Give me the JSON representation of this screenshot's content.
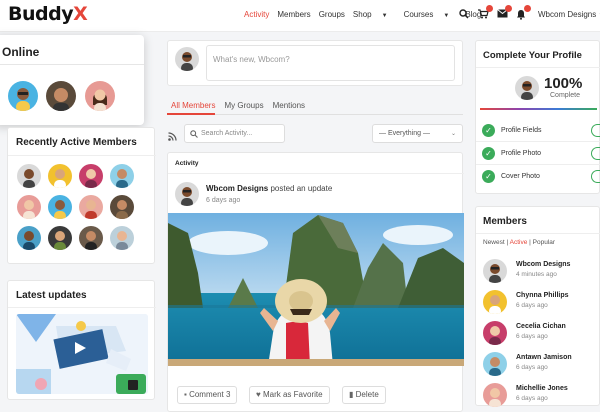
{
  "brand": {
    "name": "Buddy",
    "x": "X"
  },
  "nav": {
    "items": [
      "Activity",
      "Members",
      "Groups",
      "Shop",
      "Courses",
      "Blog"
    ],
    "user": "Wbcom Designs"
  },
  "online": {
    "title": "Online"
  },
  "recent": {
    "title": "Recently Active Members"
  },
  "latest": {
    "title": "Latest updates"
  },
  "composer": {
    "placeholder": "What's new, Wbcom?"
  },
  "tabs": [
    "All Members",
    "My Groups",
    "Mentions"
  ],
  "search": {
    "placeholder": "Search Activity..."
  },
  "filter": {
    "value": "— Everything —"
  },
  "activity": {
    "label": "Activity",
    "author": "Wbcom Designs",
    "action": " posted an update",
    "time": "6 days ago",
    "buttons": {
      "comment": "Comment 3",
      "favorite": "Mark as Favorite",
      "delete": "Delete"
    }
  },
  "profile": {
    "title": "Complete Your Profile",
    "percent": "100%",
    "percent_value": 100,
    "complete": "Complete",
    "items": [
      "Profile Fields",
      "Profile Photo",
      "Cover Photo"
    ]
  },
  "members": {
    "title": "Members",
    "filters": [
      "Newest",
      "Active",
      "Popular"
    ],
    "list": [
      {
        "name": "Wbcom Designs",
        "time": "4 minutes ago"
      },
      {
        "name": "Chynna Phillips",
        "time": "6 days ago"
      },
      {
        "name": "Cecelia Cichan",
        "time": "6 days ago"
      },
      {
        "name": "Antawn Jamison",
        "time": "6 days ago"
      },
      {
        "name": "Michellie Jones",
        "time": "6 days ago"
      }
    ]
  },
  "colors": {
    "accent": "#e5463a",
    "success": "#3bab5a"
  }
}
